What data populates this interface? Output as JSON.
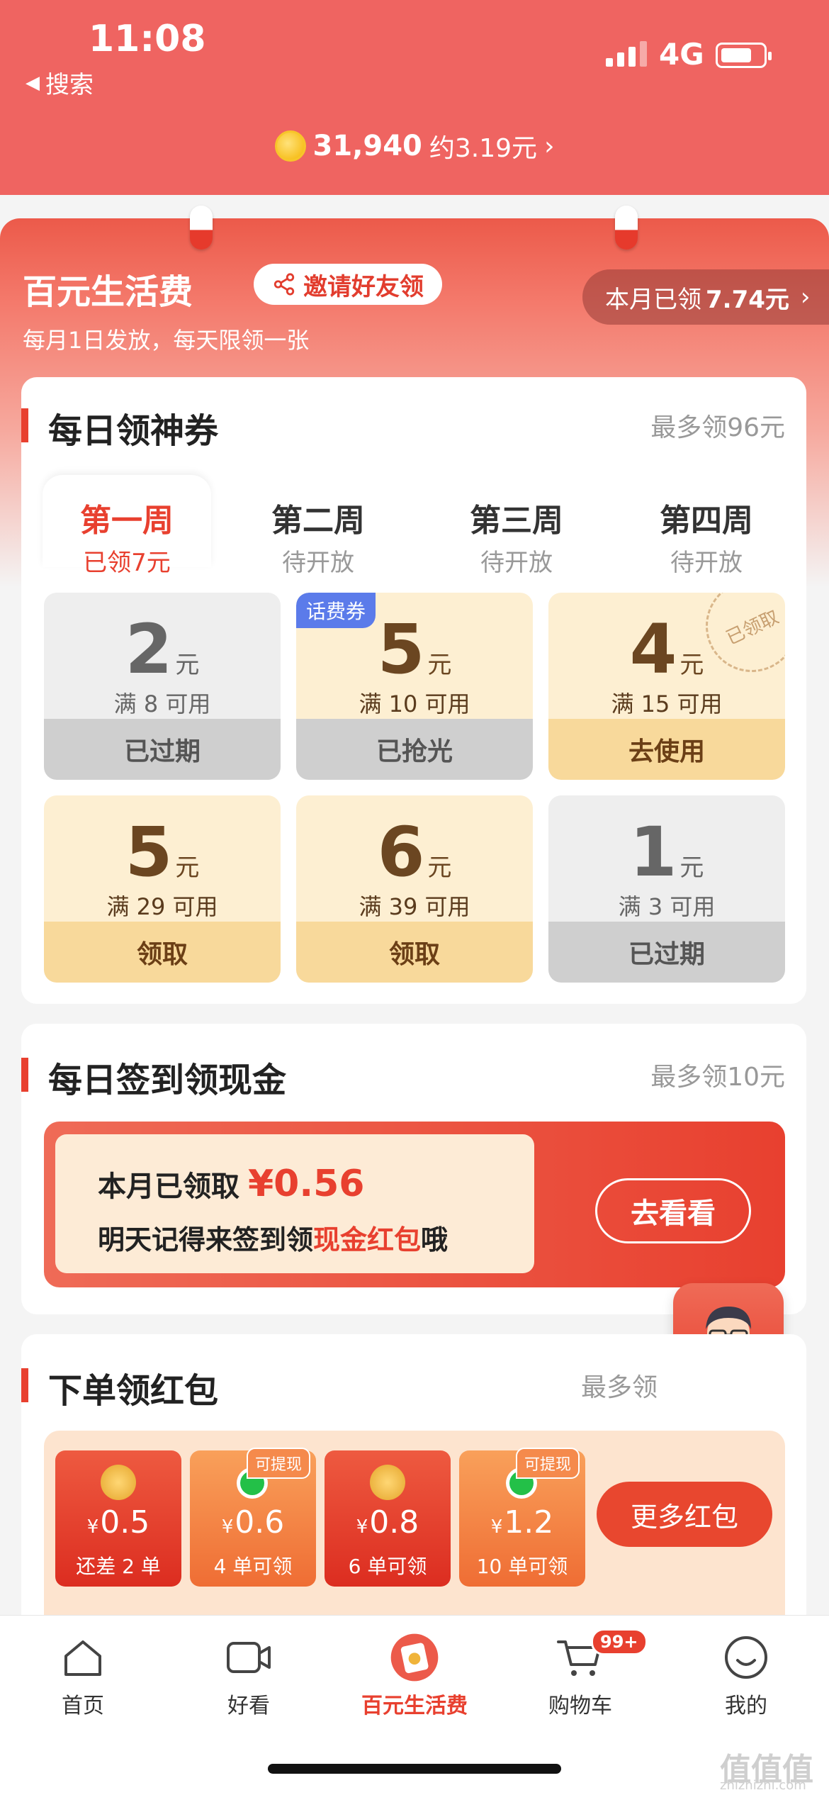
{
  "status": {
    "time": "11:08",
    "back_label": "搜索",
    "network": "4G"
  },
  "header": {
    "coins": "31,940",
    "coins_value": "约3.19元",
    "chevron": "›"
  },
  "panel": {
    "title": "百元生活费",
    "invite_label": "邀请好友领",
    "subtitle": "每月1日发放，每天限领一张",
    "claimed_prefix": "本月已领",
    "claimed_amount": "7.74元",
    "claimed_chevron": "›"
  },
  "daily_coupon": {
    "title": "每日领神券",
    "right": "最多领96元",
    "tabs": [
      {
        "label": "第一周",
        "sub": "已领7元"
      },
      {
        "label": "第二周",
        "sub": "待开放"
      },
      {
        "label": "第三周",
        "sub": "待开放"
      },
      {
        "label": "第四周",
        "sub": "待开放"
      }
    ],
    "coupons": [
      {
        "amount": "2",
        "unit": "元",
        "cond": "满 8 可用",
        "action": "已过期"
      },
      {
        "amount": "5",
        "unit": "元",
        "cond": "满 10 可用",
        "action": "已抢光",
        "tag": "话费券"
      },
      {
        "amount": "4",
        "unit": "元",
        "cond": "满 15 可用",
        "action": "去使用",
        "stamp": "已领取"
      },
      {
        "amount": "5",
        "unit": "元",
        "cond": "满 29 可用",
        "action": "领取"
      },
      {
        "amount": "6",
        "unit": "元",
        "cond": "满 39 可用",
        "action": "领取"
      },
      {
        "amount": "1",
        "unit": "元",
        "cond": "满 3 可用",
        "action": "已过期"
      }
    ]
  },
  "sign_in": {
    "title": "每日签到领现金",
    "right": "最多领10元",
    "line1_prefix": "本月已领取",
    "line1_amount": "¥0.56",
    "line2_prefix": "明天记得来签到领",
    "line2_highlight": "现金红包",
    "line2_suffix": "哦",
    "button": "去看看"
  },
  "order": {
    "title": "下单领红包",
    "right": "最多领",
    "packets": [
      {
        "currency": "¥",
        "value": "0.5",
        "cond": "还差 2 单"
      },
      {
        "currency": "¥",
        "value": "0.6",
        "cond": "4 单可领",
        "tag": "可提现"
      },
      {
        "currency": "¥",
        "value": "0.8",
        "cond": "6 单可领"
      },
      {
        "currency": "¥",
        "value": "1.2",
        "cond": "10 单可领",
        "tag": "可提现"
      }
    ],
    "more_button": "更多红包"
  },
  "nav": {
    "items": [
      {
        "label": "首页",
        "icon": "home-icon"
      },
      {
        "label": "好看",
        "icon": "video-icon"
      },
      {
        "label": "百元生活费",
        "icon": "red-envelope-icon"
      },
      {
        "label": "购物车",
        "icon": "cart-icon"
      },
      {
        "label": "我的",
        "icon": "smile-icon"
      }
    ],
    "cart_badge": "99+"
  },
  "watermark": {
    "logo": "值值值",
    "url": "zhizhizhi.com"
  },
  "colors": {
    "brand_red": "#e8402f",
    "header_bg": "#ef6461",
    "gold_bg": "#fdefd2",
    "gold_btn": "#f8d99b"
  }
}
